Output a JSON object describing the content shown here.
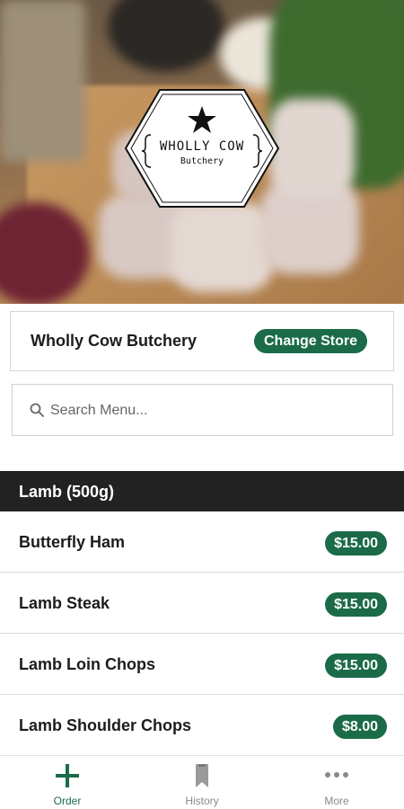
{
  "hero": {
    "logo_title": "WHOLLY COW",
    "logo_subtitle": "Butchery"
  },
  "store": {
    "name": "Wholly Cow Butchery",
    "change_label": "Change Store"
  },
  "search": {
    "placeholder": "Search Menu..."
  },
  "category": {
    "title": "Lamb (500g)"
  },
  "items": [
    {
      "name": "Butterfly Ham",
      "price": "$15.00"
    },
    {
      "name": "Lamb Steak",
      "price": "$15.00"
    },
    {
      "name": "Lamb Loin Chops",
      "price": "$15.00"
    },
    {
      "name": "Lamb Shoulder Chops",
      "price": "$8.00"
    }
  ],
  "nav": [
    {
      "label": "Order",
      "icon": "plus-icon",
      "active": true
    },
    {
      "label": "History",
      "icon": "bookmark-icon",
      "active": false
    },
    {
      "label": "More",
      "icon": "more-dots-icon",
      "active": false
    }
  ],
  "colors": {
    "accent": "#1b6b49",
    "category_bar": "#222222"
  }
}
